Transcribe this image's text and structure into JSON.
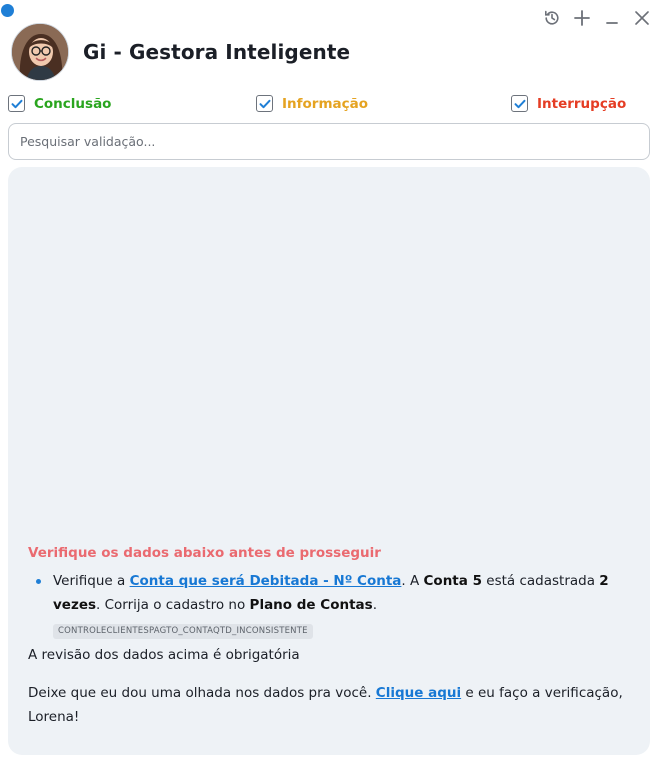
{
  "app": {
    "title": "Gi - Gestora Inteligente",
    "icons": [
      "history-icon",
      "plus-icon",
      "minimize-icon",
      "close-icon"
    ]
  },
  "filters": {
    "conclusion": {
      "label": "Conclusão",
      "checked": true,
      "color": "#2aa51f"
    },
    "information": {
      "label": "Informação",
      "checked": true,
      "color": "#e5a321"
    },
    "interruption": {
      "label": "Interrupção",
      "checked": true,
      "color": "#e53d24"
    }
  },
  "search": {
    "placeholder": "Pesquisar validação...",
    "value": ""
  },
  "message": {
    "warning_title": "Verifique os dados abaixo antes de prosseguir",
    "warning_color": "#ea6a70",
    "item": {
      "t1": "Verifique a ",
      "link": "Conta que será Debitada - Nº Conta",
      "t2": ". A ",
      "b1": "Conta 5",
      "t3": " está cadastrada ",
      "b2": "2 vezes",
      "t4": ". Corrija o cadastro no ",
      "b3": "Plano de Contas",
      "t5": ".",
      "code": "CONTROLECLIENTESPAGTO_CONTAQTD_INCONSISTENTE"
    },
    "required": "A revisão dos dados acima é obrigatória",
    "help": {
      "t1": "Deixe que eu dou uma olhada nos dados pra você. ",
      "link": "Clique aqui",
      "t2": " e eu faço a verificação, Lorena!"
    }
  },
  "colors": {
    "accent": "#1f7fd6",
    "link": "#1778d4",
    "panel": "#eef2f6"
  }
}
